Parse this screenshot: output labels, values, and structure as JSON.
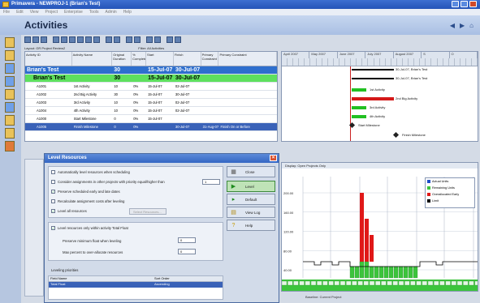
{
  "window": {
    "title": "Primavera - NEWPROJ-1 (Brian's Test)"
  },
  "menu": [
    "File",
    "Edit",
    "View",
    "Project",
    "Enterprise",
    "Tools",
    "Admin",
    "Help"
  ],
  "header": {
    "title": "Activities"
  },
  "layout": {
    "label": "Layout: GR Project Review2",
    "filter": "Filter: All Activities"
  },
  "columns": [
    "Activity ID",
    "Activity Name",
    "Original Duration",
    "% Complete",
    "Start",
    "Finish",
    "Primary Constraint",
    "Primary Constraint"
  ],
  "rows": [
    {
      "id": "Brian's Test",
      "name": "",
      "dur": "30",
      "pct": "",
      "start": "15-Jul-07",
      "finish": "30-Jul-07",
      "c1": "",
      "c2": "",
      "kind": "proj"
    },
    {
      "id": "Brian's Test",
      "name": "",
      "dur": "30",
      "pct": "",
      "start": "15-Jul-07",
      "finish": "30-Jul-07",
      "c1": "",
      "c2": "",
      "kind": "wbs"
    },
    {
      "id": "A1001",
      "name": "1st Activity",
      "dur": "10",
      "pct": "0%",
      "start": "15-Jul-07",
      "finish": "02-Jul-07",
      "c1": "",
      "c2": "",
      "kind": "act"
    },
    {
      "id": "A1002",
      "name": "2nd Big Activity",
      "dur": "30",
      "pct": "0%",
      "start": "15-Jul-07",
      "finish": "30-Jul-07",
      "c1": "",
      "c2": "",
      "kind": "act"
    },
    {
      "id": "A1003",
      "name": "3rd Activity",
      "dur": "10",
      "pct": "0%",
      "start": "15-Jul-07",
      "finish": "02-Jul-07",
      "c1": "",
      "c2": "",
      "kind": "act"
    },
    {
      "id": "A1004",
      "name": "4th Activity",
      "dur": "10",
      "pct": "0%",
      "start": "15-Jul-07",
      "finish": "02-Jul-07",
      "c1": "",
      "c2": "",
      "kind": "act"
    },
    {
      "id": "A1000",
      "name": "Start Milestone",
      "dur": "0",
      "pct": "0%",
      "start": "15-Jul-07",
      "finish": "",
      "c1": "",
      "c2": "",
      "kind": "act"
    },
    {
      "id": "A1005",
      "name": "Finish Milestone",
      "dur": "0",
      "pct": "0%",
      "start": "",
      "finish": "30-Jul-07",
      "c1": "31-Aug-07",
      "c2": "Finish On or Before",
      "kind": "sel"
    }
  ],
  "gantt": {
    "months": [
      "April 2007",
      "May 2007",
      "June 2007",
      "July 2007",
      "August 2007",
      "S",
      "O"
    ],
    "labels": [
      "30-Jul-07, Brian's Test",
      "30-Jul-07, Brian's Test",
      "1st Activity",
      "2nd Big Activity",
      "3rd Activity",
      "4th Activity",
      "Start Milestone",
      "Finish Milestone"
    ]
  },
  "dialog": {
    "title": "Level Resources",
    "options": [
      {
        "label": "Automatically level resources when scheduling",
        "checked": false
      },
      {
        "label": "Consider assignments in other projects with priority equal/higher than",
        "checked": false
      },
      {
        "label": "Preserve scheduled early and late dates",
        "checked": true
      },
      {
        "label": "Recalculate assignment costs after leveling",
        "checked": false
      },
      {
        "label": "Level all resources",
        "checked": true
      }
    ],
    "priority_value": "1",
    "select_resources": "Select Resources...",
    "float_option": {
      "label": "Level resources only within activity Total Float",
      "checked": true
    },
    "preserve_float_label": "Preserve minimum float when leveling",
    "preserve_float_value": "0",
    "overalloc_label": "Max percent to over-allocate resources",
    "overalloc_value": "0",
    "priorities_label": "Leveling priorities",
    "priority_head": [
      "Field Name",
      "Sort Order"
    ],
    "priority_row": [
      "Total Float",
      "Ascending"
    ],
    "buttons": [
      "Close",
      "Level",
      "Default",
      "View Log",
      "Help"
    ]
  },
  "histogram": {
    "display": "Display: Open Projects Only",
    "y_ticks": [
      "200.00",
      "160.00",
      "120.00",
      "80.00",
      "40.00"
    ],
    "legend": [
      {
        "label": "Actual Units",
        "color": "#1f4fc8"
      },
      {
        "label": "Remaining Units",
        "color": "#3cc43c"
      },
      {
        "label": "Overallocated Early",
        "color": "#e01818"
      },
      {
        "label": "Limit",
        "color": "#000000"
      }
    ],
    "status": [
      "Baseline: Current Project"
    ]
  },
  "colors": {
    "accent": "#2e6fce",
    "wbs": "#5ee05e",
    "bar_green": "#22c022",
    "bar_red": "#d41818"
  }
}
